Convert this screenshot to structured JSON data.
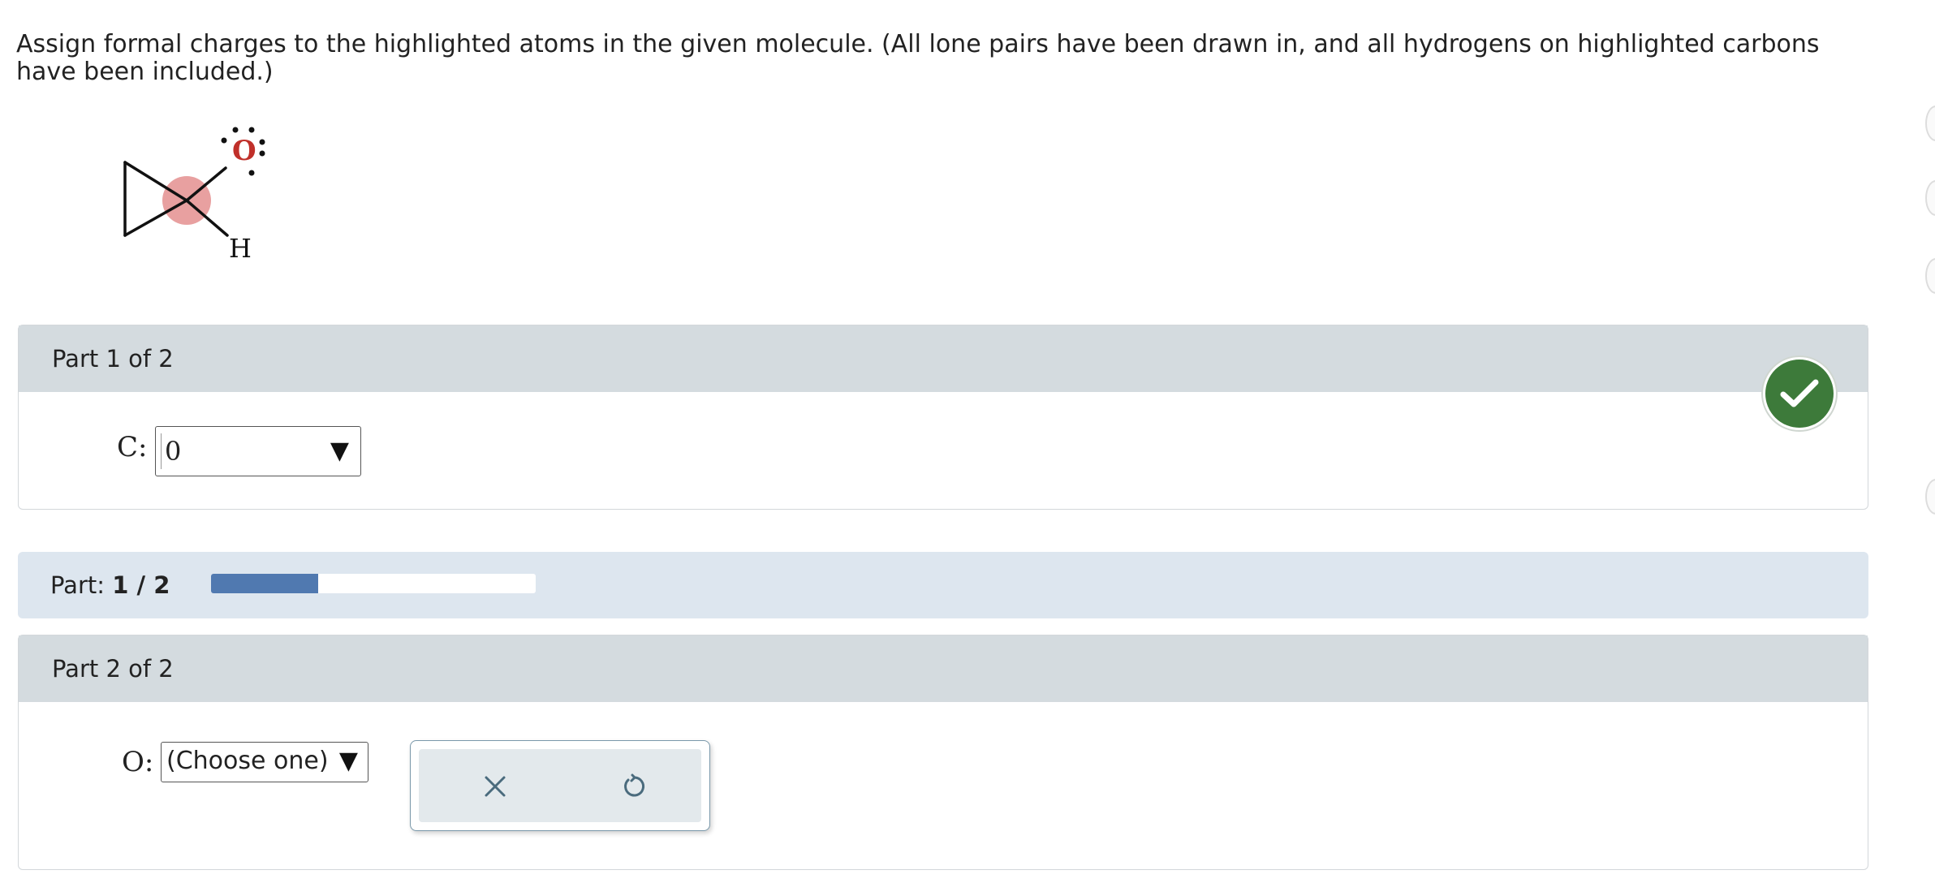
{
  "question": "Assign formal charges to the highlighted atoms in the given molecule. (All lone pairs have been drawn in, and all hydrogens on highlighted carbons have been included.)",
  "molecule": {
    "atom_oxygen": "O",
    "atom_hydrogen": "H",
    "highlight_color": "#e8a0a0",
    "oxygen_color": "#c0302a"
  },
  "part1": {
    "header": "Part 1 of 2",
    "atom_label": "C:",
    "selected_value": "0",
    "status": "correct",
    "status_color": "#3d7a3a"
  },
  "progress": {
    "label": "Part:",
    "value_text": "1 / 2",
    "fraction": 0.33,
    "fill_color": "#5079b0"
  },
  "part2": {
    "header": "Part 2 of 2",
    "atom_label": "O:",
    "selected_value": "(Choose one)",
    "clear_icon": "x-icon",
    "undo_icon": "undo-icon"
  }
}
